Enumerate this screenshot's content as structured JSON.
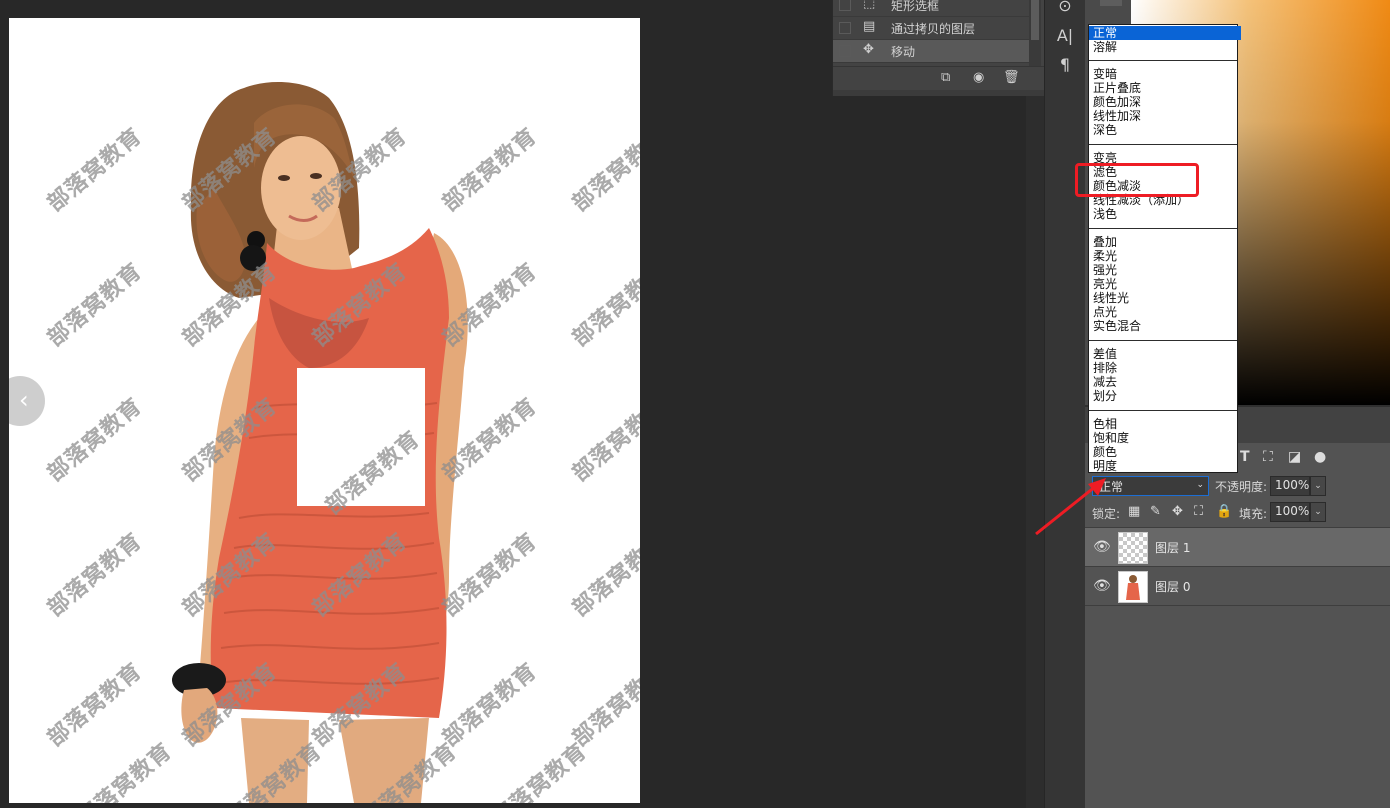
{
  "canvas": {
    "watermark_text": "部落窝教育"
  },
  "history": {
    "items": [
      {
        "icon": "rectangle-marquee-icon",
        "label": "矩形选框"
      },
      {
        "icon": "layer-copy-icon",
        "label": "通过拷贝的图层"
      },
      {
        "icon": "move-icon",
        "label": "移动"
      }
    ]
  },
  "blend_modes": {
    "groups": [
      [
        "正常",
        "溶解"
      ],
      [
        "变暗",
        "正片叠底",
        "颜色加深",
        "线性加深",
        "深色"
      ],
      [
        "变亮",
        "滤色",
        "颜色减淡",
        "线性减淡（添加）",
        "浅色"
      ],
      [
        "叠加",
        "柔光",
        "强光",
        "亮光",
        "线性光",
        "点光",
        "实色混合"
      ],
      [
        "差值",
        "排除",
        "减去",
        "划分"
      ],
      [
        "色相",
        "饱和度",
        "颜色",
        "明度"
      ]
    ],
    "selected": "正常"
  },
  "layers_panel": {
    "blend_value": "正常",
    "opacity_label": "不透明度:",
    "opacity_value": "100%",
    "lock_label": "锁定:",
    "fill_label": "填充:",
    "fill_value": "100%",
    "layers": [
      {
        "name": "图层 1",
        "thumb": "transparent"
      },
      {
        "name": "图层 0",
        "thumb": "photo"
      }
    ]
  },
  "colors": {
    "highlight": "#0a64d6",
    "annotation_red": "#ee1c24",
    "dress": "#e5654a"
  }
}
